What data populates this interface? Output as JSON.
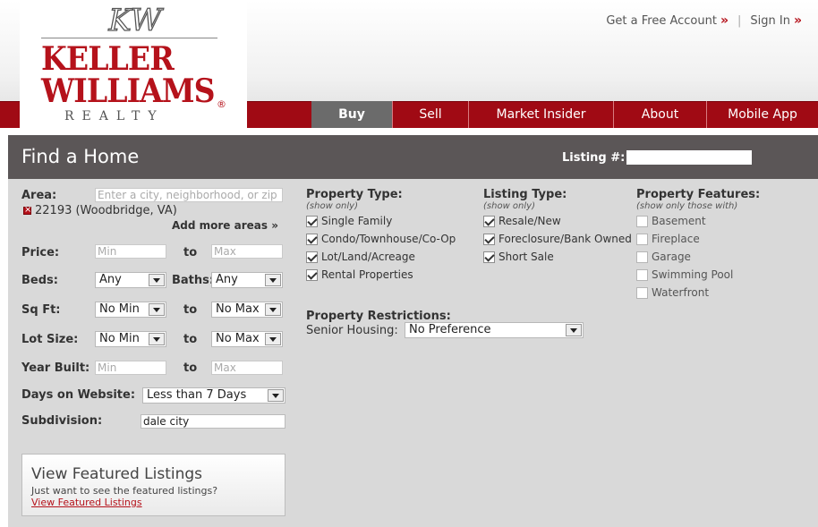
{
  "brand": {
    "logo_line1": "KELLER",
    "logo_line2": "WILLIAMS",
    "logo_sub": "REALTY",
    "monogram": "KW",
    "reg_mark": "®",
    "color": "#b5121b"
  },
  "toplinks": {
    "account": "Get a Free Account",
    "separator": "|",
    "signin": "Sign In",
    "chevron": "»"
  },
  "nav": {
    "items": [
      {
        "label": "Buy",
        "active": true
      },
      {
        "label": "Sell"
      },
      {
        "label": "Market Insider"
      },
      {
        "label": "About"
      },
      {
        "label": "Mobile App"
      }
    ]
  },
  "panel": {
    "title": "Find a Home",
    "listing_label": "Listing #:",
    "listing_value": ""
  },
  "form": {
    "area_label": "Area:",
    "area_placeholder": "Enter a city, neighborhood, or zip",
    "area_selected": "22193 (Woodbridge, VA)",
    "add_more": "Add more areas »",
    "price_label": "Price:",
    "price_min_placeholder": "Min",
    "price_max_placeholder": "Max",
    "to": "to",
    "beds_label": "Beds:",
    "beds_value": "Any",
    "baths_label": "Baths:",
    "baths_value": "Any",
    "sqft_label": "Sq Ft:",
    "sqft_min": "No Min",
    "sqft_max": "No Max",
    "lot_label": "Lot Size:",
    "lot_min": "No Min",
    "lot_max": "No Max",
    "year_label": "Year Built:",
    "year_min_placeholder": "Min",
    "year_max_placeholder": "Max",
    "days_label": "Days on Website:",
    "days_value": "Less than 7 Days",
    "subdivision_label": "Subdivision:",
    "subdivision_value": "dale city"
  },
  "property_type": {
    "title": "Property Type:",
    "sub": "(show only)",
    "items": [
      {
        "label": "Single Family",
        "checked": true
      },
      {
        "label": "Condo/Townhouse/Co-Op",
        "checked": true
      },
      {
        "label": "Lot/Land/Acreage",
        "checked": true
      },
      {
        "label": "Rental Properties",
        "checked": true
      }
    ]
  },
  "listing_type": {
    "title": "Listing Type:",
    "sub": "(show only)",
    "items": [
      {
        "label": "Resale/New",
        "checked": true
      },
      {
        "label": "Foreclosure/Bank Owned",
        "checked": true
      },
      {
        "label": "Short Sale",
        "checked": true
      }
    ]
  },
  "features": {
    "title": "Property Features:",
    "sub": "(show only those with)",
    "items": [
      {
        "label": "Basement",
        "checked": false
      },
      {
        "label": "Fireplace",
        "checked": false
      },
      {
        "label": "Garage",
        "checked": false
      },
      {
        "label": "Swimming Pool",
        "checked": false
      },
      {
        "label": "Waterfront",
        "checked": false
      }
    ]
  },
  "restrictions": {
    "title": "Property Restrictions:",
    "senior_label": "Senior Housing:",
    "senior_value": "No Preference"
  },
  "featured": {
    "title": "View Featured Listings",
    "sub": "Just want to see the featured listings?",
    "link": "View Featured Listings"
  }
}
